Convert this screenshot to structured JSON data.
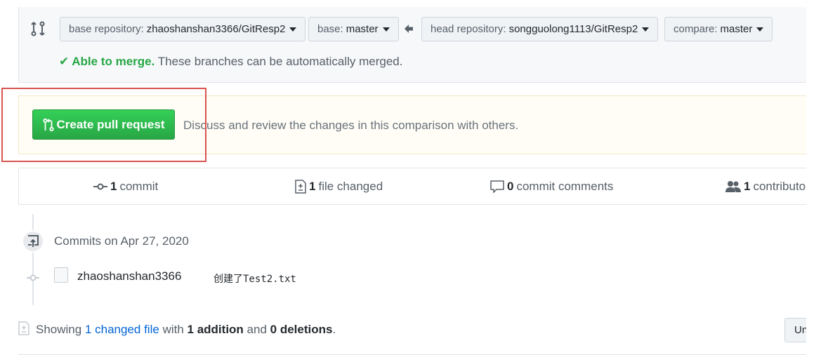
{
  "range": {
    "base_repo_label": "base repository:",
    "base_repo_value": "zhaoshanshan3366/GitResp2",
    "base_label": "base:",
    "base_value": "master",
    "head_repo_label": "head repository:",
    "head_repo_value": "songguolong1113/GitResp2",
    "compare_label": "compare:",
    "compare_value": "master"
  },
  "merge": {
    "check_icon": "check-icon",
    "status": "Able to merge.",
    "detail": "These branches can be automatically merged."
  },
  "pr": {
    "button_label": "Create pull request",
    "description": "Discuss and review the changes in this comparison with others."
  },
  "summary": {
    "commits_count": "1",
    "commits_label": "commit",
    "files_count": "1",
    "files_label": "file changed",
    "comments_count": "0",
    "comments_label": "commit comments",
    "contributors_count": "1",
    "contributors_label": "contributo"
  },
  "commits": {
    "day_label": "Commits on Apr 27, 2020",
    "items": [
      {
        "author": "zhaoshanshan3366",
        "message": "创建了Test2.txt"
      }
    ]
  },
  "files": {
    "showing": "Showing",
    "changed_link": "1 changed file",
    "with": "with",
    "additions": "1 addition",
    "and": "and",
    "deletions": "0 deletions",
    "period": ".",
    "unified_label": "Unified"
  },
  "colors": {
    "success": "#28a745",
    "link": "#0366d6",
    "highlight": "#d9534f"
  }
}
